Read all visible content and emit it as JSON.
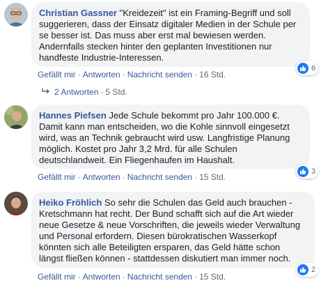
{
  "colors": {
    "link": "#385898",
    "bubble": "#f2f3f5",
    "like": "#2078f4",
    "meta": "#606770"
  },
  "comments": [
    {
      "author": "Christian Gassner",
      "text": "\"Kreidezeit\" ist ein Framing-Begriff und soll suggerieren, dass der Einsatz digitaler Medien in der Schule per se besser ist. Das muss aber erst mal bewiesen werden. Andernfalls stecken hinter den geplanten Investitionen nur handfeste Industrie-Interessen.",
      "like": "Gefällt mir",
      "reply": "Antworten",
      "message": "Nachricht senden",
      "time": "16 Std.",
      "likes": "6"
    },
    {
      "author": "Hannes Piefsen",
      "text": "Jede Schule bekommt pro Jahr 100.000 €. Damit kann man entscheiden, wo die Kohle sinnvoll eingesetzt wird, was an Technik gebraucht wird usw. Langfristige Planung möglich. Kostet pro Jahr 3,2 Mrd. für alle Schulen deutschlandweit. Ein Fliegenhaufen im Haushalt.",
      "like": "Gefällt mir",
      "reply": "Antworten",
      "message": "Nachricht senden",
      "time": "15 Std.",
      "likes": "3"
    },
    {
      "author": "Heiko Fröhlich",
      "text": "So sehr die Schulen das Geld auch brauchen - Kretschmann hat recht. Der Bund schafft sich auf die Art wieder neue Gesetze & neue Vorschriften, die jeweils wieder Verwaltung und Personal erfordern. Diesen bürokratischen Wasserkopf könnten sich alle Beteiligten ersparen, das Geld hätte schon längst fließen können - stattdessen diskutiert man immer noch.",
      "like": "Gefällt mir",
      "reply": "Antworten",
      "message": "Nachricht senden",
      "time": "15 Std.",
      "likes": "2"
    }
  ],
  "replies": {
    "label": "2 Antworten",
    "time": "5 Std."
  },
  "icons": {
    "reply_arrow": "reply-arrow-icon",
    "like": "thumbs-up-icon"
  }
}
